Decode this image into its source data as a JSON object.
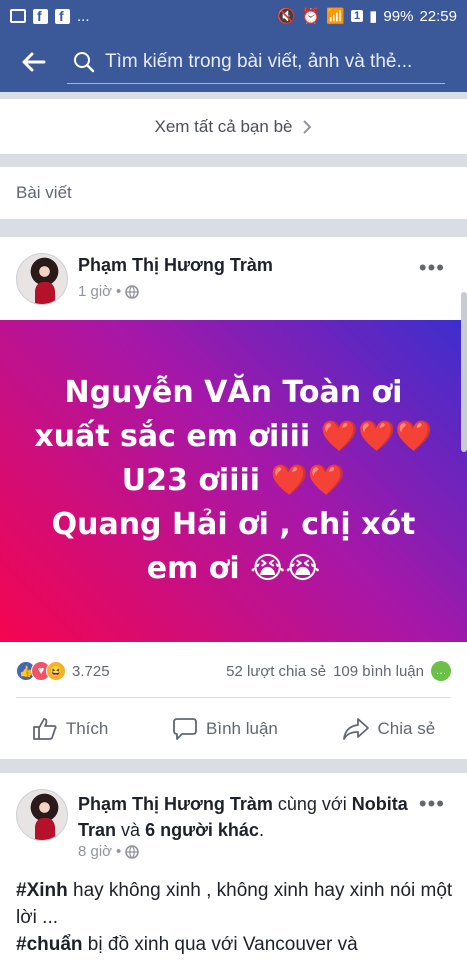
{
  "status_bar": {
    "battery": "99%",
    "time": "22:59",
    "sim_badge": "1"
  },
  "search": {
    "placeholder": "Tìm kiếm trong bài viết, ảnh và thẻ..."
  },
  "friends": {
    "see_all": "Xem tất cả bạn bè"
  },
  "posts_section": {
    "title": "Bài viết"
  },
  "post1": {
    "author": "Phạm Thị Hương Tràm",
    "time": "1 giờ",
    "text": "Nguyễn VĂn Toàn ơi xuất sắc em ơiiii ❤️❤️❤️\nU23 ơiiii ❤️❤️\nQuang Hải ơi , chị xót em ơi 😭😭",
    "reactions_count": "3.725",
    "shares": "52 lượt chia sẻ",
    "comments": "109 bình luận",
    "actions": {
      "like": "Thích",
      "comment": "Bình luận",
      "share": "Chia sẻ"
    }
  },
  "post2": {
    "author": "Phạm Thị Hương Tràm",
    "with_text": "cùng với",
    "tagged": "Nobita Tran",
    "and_text": "và",
    "others": "6 người khác",
    "period": ".",
    "time": "8 giờ",
    "hashtag1": "#Xinh",
    "line1": " hay không xinh , không xinh hay xinh nói một lời ...",
    "hashtag2": "#chuẩn",
    "line2": " bị đồ xinh qua với Vancouver và"
  },
  "colors": {
    "brand": "#3b5998",
    "like": "#4267b2",
    "love": "#f25268",
    "haha": "#f7b125",
    "comment_badge": "#44bec7"
  },
  "icons": [
    "back-arrow-icon",
    "search-icon",
    "chevron-right-icon",
    "globe-icon",
    "more-dots-icon",
    "like-icon",
    "comment-icon",
    "share-icon"
  ]
}
